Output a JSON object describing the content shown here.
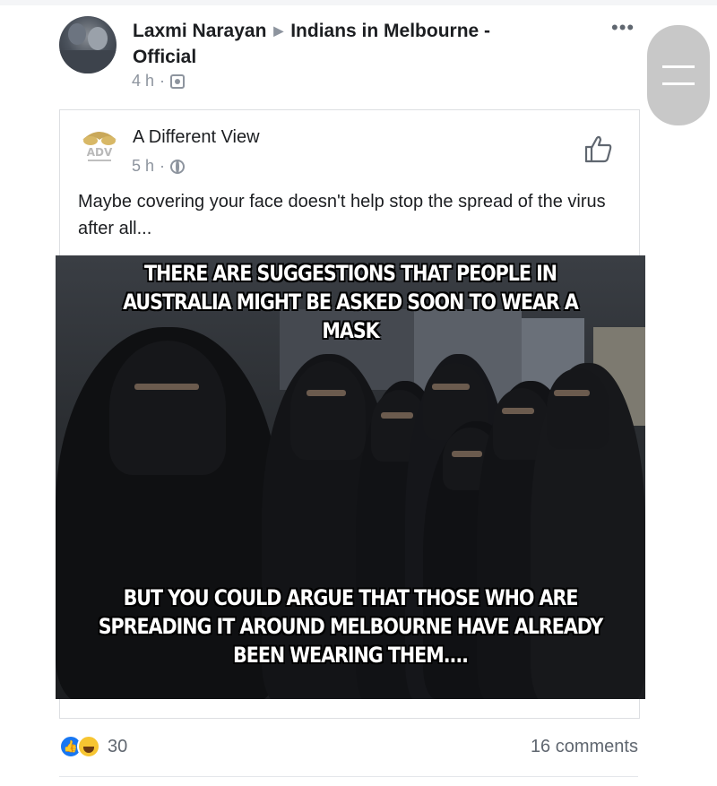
{
  "post": {
    "author": "Laxmi Narayan",
    "group": "Indians in Melbourne - Official",
    "time": "4 h",
    "more_label": "•••"
  },
  "shared": {
    "page_name": "A Different View",
    "logo_text": "ADV",
    "time": "5 h",
    "caption": "Maybe covering your face doesn't help stop the spread of the virus after all...",
    "meme_top_text": "There are suggestions that people in Australia might be asked soon to wear a mask",
    "meme_bottom_text": "But you could argue that those who are spreading it around Melbourne have already been wearing them...."
  },
  "footer": {
    "reaction_count": "30",
    "comments": "16 comments"
  },
  "colors": {
    "accent": "#1877f2",
    "meta_gray": "#8d949e",
    "text": "#1c1e21"
  }
}
